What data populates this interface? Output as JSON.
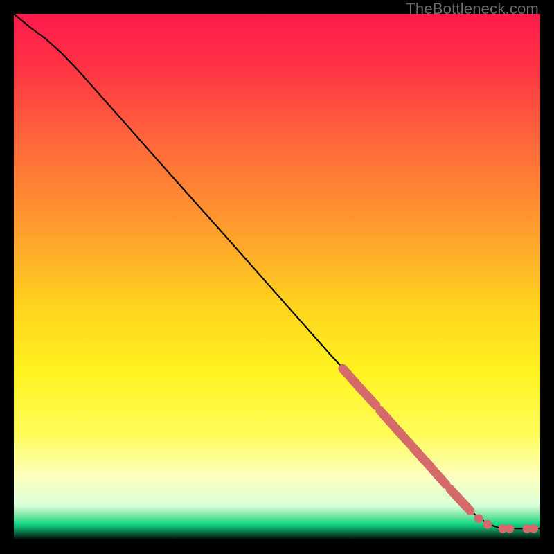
{
  "watermark": "TheBottleneck.com",
  "chart_data": {
    "type": "line",
    "title": "",
    "xlabel": "",
    "ylabel": "",
    "xlim": [
      0,
      100
    ],
    "ylim": [
      0,
      100
    ],
    "gradient_stops": [
      {
        "offset": 0,
        "color": "#ff1a4b"
      },
      {
        "offset": 0.1,
        "color": "#ff3345"
      },
      {
        "offset": 0.25,
        "color": "#ff6a3a"
      },
      {
        "offset": 0.4,
        "color": "#ff9a2f"
      },
      {
        "offset": 0.55,
        "color": "#ffd21e"
      },
      {
        "offset": 0.68,
        "color": "#fff320"
      },
      {
        "offset": 0.8,
        "color": "#fffc5a"
      },
      {
        "offset": 0.88,
        "color": "#fcffc0"
      },
      {
        "offset": 0.935,
        "color": "#d8ffd8"
      },
      {
        "offset": 0.955,
        "color": "#6fe6a0"
      },
      {
        "offset": 0.968,
        "color": "#19d98a"
      },
      {
        "offset": 0.975,
        "color": "#0fb873"
      },
      {
        "offset": 1.0,
        "color": "#000000"
      }
    ],
    "curve": [
      {
        "x": 0,
        "y": 100
      },
      {
        "x": 3,
        "y": 97.5
      },
      {
        "x": 6,
        "y": 95.3
      },
      {
        "x": 9,
        "y": 92.6
      },
      {
        "x": 12,
        "y": 89.5
      },
      {
        "x": 20,
        "y": 80.5
      },
      {
        "x": 30,
        "y": 69.2
      },
      {
        "x": 40,
        "y": 58.0
      },
      {
        "x": 50,
        "y": 46.7
      },
      {
        "x": 60,
        "y": 35.4
      },
      {
        "x": 65,
        "y": 30.0
      },
      {
        "x": 70,
        "y": 24.3
      },
      {
        "x": 75,
        "y": 18.7
      },
      {
        "x": 80,
        "y": 13.0
      },
      {
        "x": 85,
        "y": 7.4
      },
      {
        "x": 88,
        "y": 4.5
      },
      {
        "x": 90,
        "y": 3.1
      },
      {
        "x": 92,
        "y": 2.4
      },
      {
        "x": 94,
        "y": 2.2
      },
      {
        "x": 96,
        "y": 2.2
      },
      {
        "x": 98,
        "y": 2.2
      },
      {
        "x": 100,
        "y": 2.2
      }
    ],
    "marker_segments": [
      {
        "x1": 62.5,
        "y1": 32.6,
        "x2": 66.3,
        "y2": 28.3
      },
      {
        "x1": 66.7,
        "y1": 27.9,
        "x2": 68.8,
        "y2": 25.6
      },
      {
        "x1": 69.6,
        "y1": 24.6,
        "x2": 74.6,
        "y2": 19.0
      },
      {
        "x1": 75.0,
        "y1": 18.6,
        "x2": 77.9,
        "y2": 15.3
      },
      {
        "x1": 78.3,
        "y1": 14.9,
        "x2": 79.2,
        "y2": 13.9
      },
      {
        "x1": 79.6,
        "y1": 13.4,
        "x2": 82.1,
        "y2": 10.6
      },
      {
        "x1": 82.9,
        "y1": 9.7,
        "x2": 85.0,
        "y2": 7.4
      },
      {
        "x1": 85.4,
        "y1": 7.0,
        "x2": 86.7,
        "y2": 5.6
      }
    ],
    "marker_dots": [
      {
        "x": 88.3,
        "y": 4.1
      },
      {
        "x": 90.0,
        "y": 3.0
      },
      {
        "x": 92.9,
        "y": 2.2
      },
      {
        "x": 94.2,
        "y": 2.2
      },
      {
        "x": 97.5,
        "y": 2.2
      },
      {
        "x": 98.8,
        "y": 2.2
      }
    ],
    "marker_color": "#d46a6a"
  }
}
